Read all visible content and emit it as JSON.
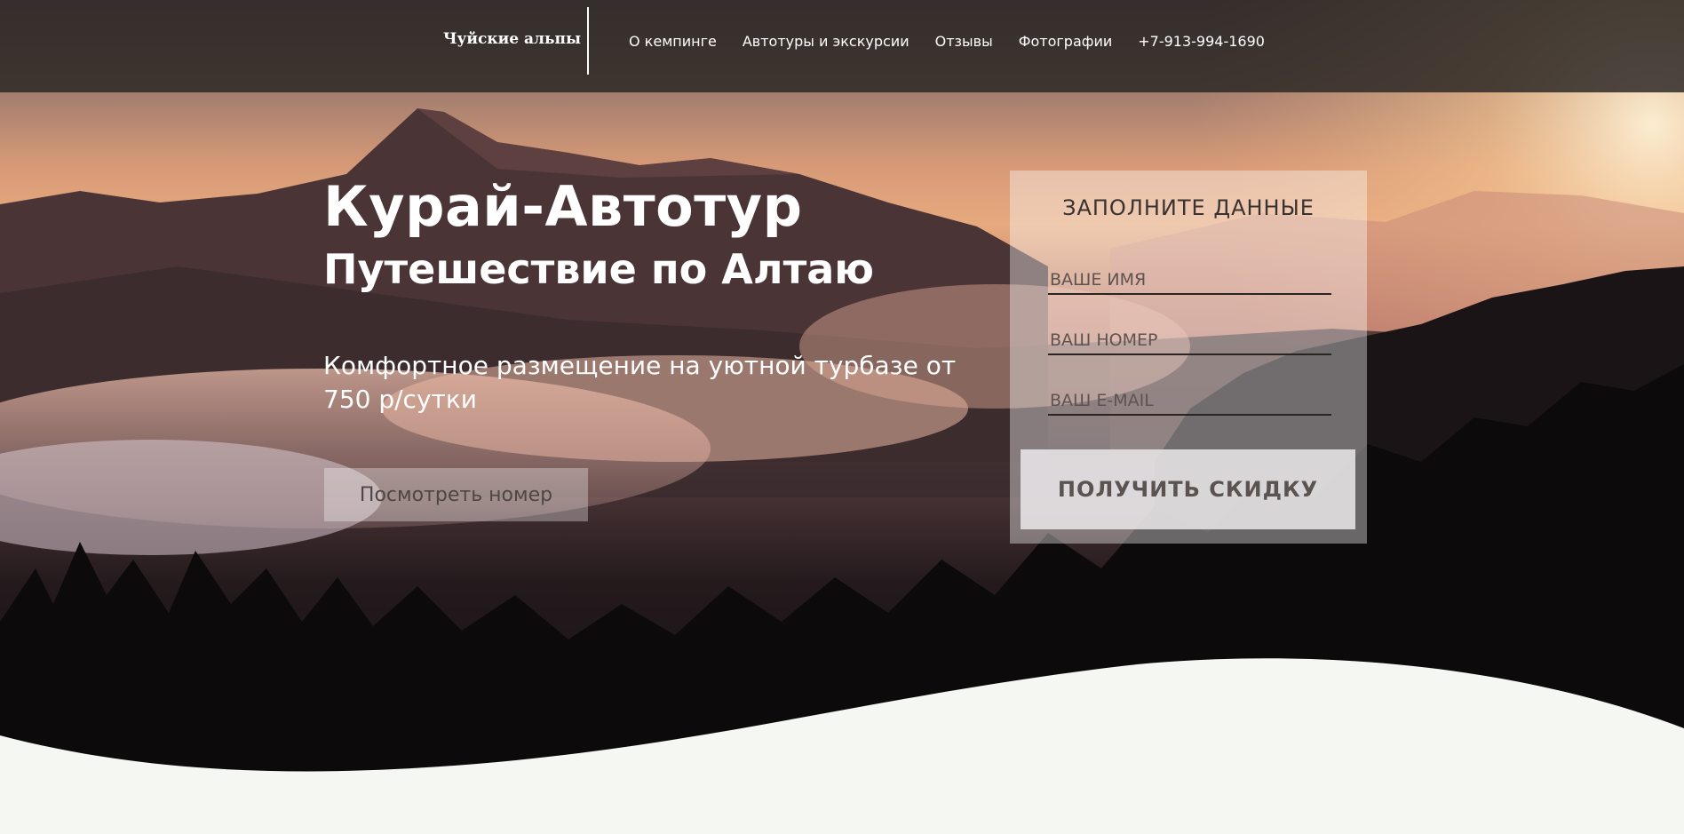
{
  "header": {
    "brand": "Чуйские альпы",
    "nav": [
      {
        "label": "О кемпинге"
      },
      {
        "label": "Автотуры и экскурсии"
      },
      {
        "label": "Отзывы"
      },
      {
        "label": "Фотографии"
      },
      {
        "label": "+7-913-994-1690"
      }
    ]
  },
  "hero": {
    "title": "Курай-Автотур",
    "subtitle": "Путешествие по Алтаю",
    "tagline": "Комфортное размещение на уютной турбазе от 750 р/сутки",
    "view_button": "Посмотреть номер"
  },
  "form": {
    "title": "ЗАПОЛНИТЕ ДАННЫЕ",
    "name_placeholder": "ВАШЕ ИМЯ",
    "phone_placeholder": "ВАШ НОМЕР",
    "email_placeholder": "ВАШ E-MAIL",
    "submit_label": "ПОЛУЧИТЬ СКИДКУ"
  },
  "colors": {
    "header_bg": "#2d2927",
    "page_bg": "#f5f7f2",
    "sky_glow": "#e7aa7e",
    "text_light": "#ffffff",
    "text_dark": "#3a3230"
  }
}
